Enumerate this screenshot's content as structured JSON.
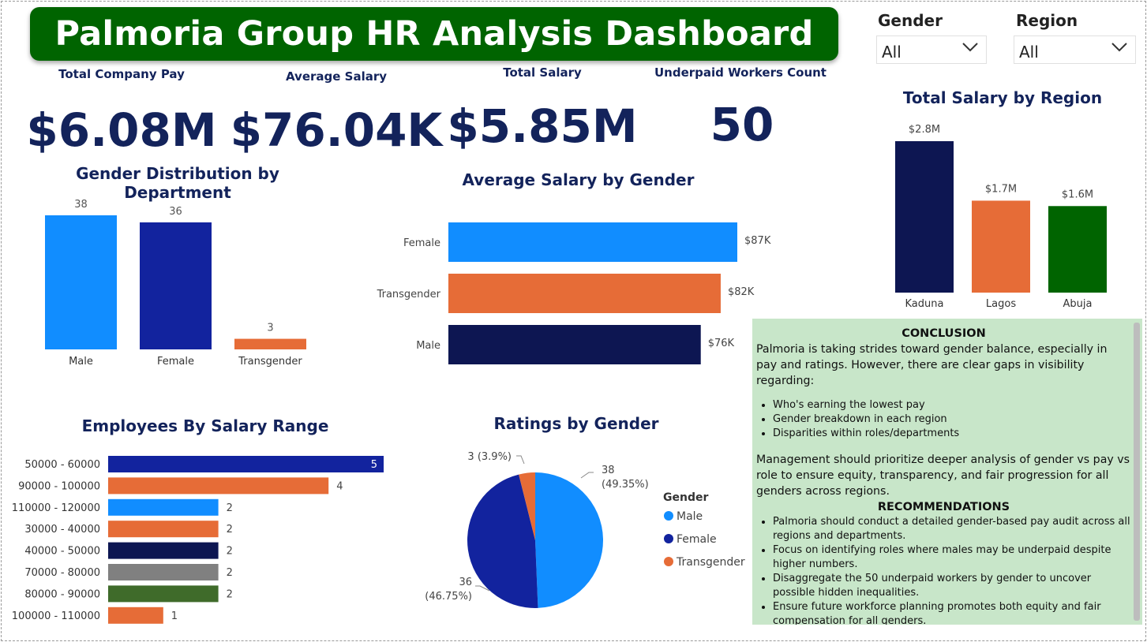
{
  "dashboard": {
    "title": "Palmoria Group HR Analysis Dashboard"
  },
  "kpis": [
    {
      "label": "Total Company Pay",
      "value": "$6.08M"
    },
    {
      "label": "Average Salary",
      "value": "$76.04K"
    },
    {
      "label": "Total Salary",
      "value": "$5.85M"
    },
    {
      "label": "Underpaid Workers Count",
      "value": "50"
    }
  ],
  "filters": {
    "gender": {
      "label": "Gender",
      "value": "All"
    },
    "region": {
      "label": "Region",
      "value": "All"
    }
  },
  "colors": {
    "title_bg": "#006400",
    "navy": "#0d1652",
    "blue": "#118dff",
    "dark_blue": "#12239e",
    "orange": "#e66c37",
    "green": "#006400",
    "note_bg": "#c8e6c9"
  },
  "chart_data": [
    {
      "type": "bar",
      "title": "Gender Distribution by Department",
      "categories": [
        "Male",
        "Female",
        "Transgender"
      ],
      "values": [
        38,
        36,
        3
      ],
      "labels": [
        "38",
        "36",
        "3"
      ],
      "colors": [
        "#118dff",
        "#12239e",
        "#e66c37"
      ]
    },
    {
      "type": "bar",
      "orientation": "horizontal",
      "title": "Average Salary by Gender",
      "categories": [
        "Female",
        "Transgender",
        "Male"
      ],
      "values": [
        87,
        82,
        76
      ],
      "labels": [
        "$87K",
        "$82K",
        "$76K"
      ],
      "colors": [
        "#118dff",
        "#e66c37",
        "#0d1652"
      ]
    },
    {
      "type": "bar",
      "title": "Total Salary by Region",
      "categories": [
        "Kaduna",
        "Lagos",
        "Abuja"
      ],
      "values": [
        2.8,
        1.7,
        1.6
      ],
      "labels": [
        "$2.8M",
        "$1.7M",
        "$1.6M"
      ],
      "colors": [
        "#0d1652",
        "#e66c37",
        "#006400"
      ]
    },
    {
      "type": "bar",
      "orientation": "horizontal",
      "title": "Employees By Salary Range",
      "categories": [
        "50000 - 60000",
        "90000 - 100000",
        "110000 - 120000",
        "30000 - 40000",
        "40000 - 50000",
        "70000 - 80000",
        "80000 - 90000",
        "100000 - 110000"
      ],
      "values": [
        5,
        4,
        2,
        2,
        2,
        2,
        2,
        1
      ],
      "labels": [
        "5",
        "4",
        "2",
        "2",
        "2",
        "2",
        "2",
        "1"
      ],
      "colors": [
        "#12239e",
        "#e66c37",
        "#118dff",
        "#e66c37",
        "#0d1652",
        "#808080",
        "#3f6b2a",
        "#e66c37"
      ]
    },
    {
      "type": "pie",
      "title": "Ratings by Gender",
      "legend_title": "Gender",
      "legend_position": "right",
      "categories": [
        "Male",
        "Female",
        "Transgender"
      ],
      "values": [
        38,
        36,
        3
      ],
      "percents": [
        "49.35%",
        "46.75%",
        "3.9%"
      ],
      "labels": [
        "38",
        "36",
        "3 (3.9%)"
      ],
      "colors": [
        "#118dff",
        "#12239e",
        "#e66c37"
      ]
    }
  ],
  "conclusion": {
    "heading": "CONCLUSION",
    "intro": "Palmoria is taking strides toward gender balance, especially in pay and ratings. However, there are clear gaps in visibility regarding:",
    "points": [
      "Who's earning the lowest pay",
      "Gender breakdown in each region",
      "Disparities within roles/departments"
    ],
    "closing": "Management should prioritize deeper analysis of gender vs pay vs role to ensure equity, transparency, and fair progression for all genders across regions."
  },
  "recommendations": {
    "heading": "RECOMMENDATIONS",
    "items": [
      "Palmoria should conduct a detailed gender-based pay audit across all regions and departments.",
      "Focus on identifying roles where males may be underpaid despite higher numbers.",
      "Disaggregate the 50 underpaid workers by gender to uncover possible hidden inequalities.",
      "Ensure future workforce planning promotes both equity and fair compensation for all genders."
    ]
  }
}
